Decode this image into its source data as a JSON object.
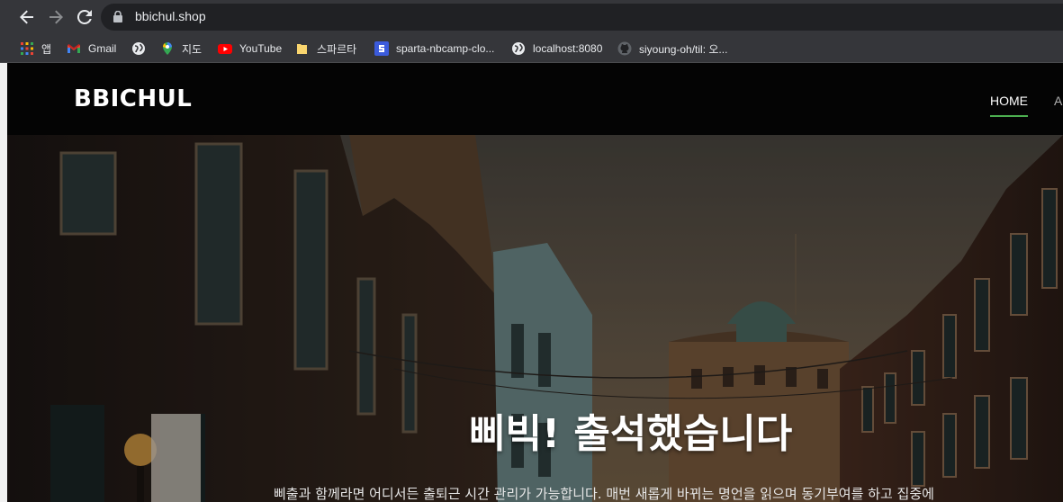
{
  "browser": {
    "url": "bbichul.shop",
    "bookmarks": [
      {
        "label": "앱",
        "icon": "apps-grid-icon"
      },
      {
        "label": "Gmail",
        "icon": "gmail-icon"
      },
      {
        "label": "",
        "icon": "globe-icon"
      },
      {
        "label": "지도",
        "icon": "maps-pin-icon"
      },
      {
        "label": "YouTube",
        "icon": "youtube-icon"
      },
      {
        "label": "스파르타",
        "icon": "folder-icon"
      },
      {
        "label": "sparta-nbcamp-clo...",
        "icon": "sparta-icon"
      },
      {
        "label": "localhost:8080",
        "icon": "globe-icon"
      },
      {
        "label": "siyoung-oh/til: 오...",
        "icon": "github-icon"
      }
    ]
  },
  "site": {
    "brand": "BBICHUL",
    "nav": [
      {
        "label": "HOME",
        "active": true
      },
      {
        "label": "A",
        "active": false
      }
    ],
    "hero": {
      "title": "삐빅! 출석했습니다",
      "subtitle": "삐출과 함께라면 어디서든 출퇴근 시간 관리가 가능합니다. 매번 새롭게 바뀌는 명언을 읽으며 동기부여를 하고 집중에"
    }
  },
  "colors": {
    "chrome": "#35363a",
    "omnibox": "#202124",
    "navbar": "#040404",
    "nav_active_underline": "#4caf50"
  }
}
